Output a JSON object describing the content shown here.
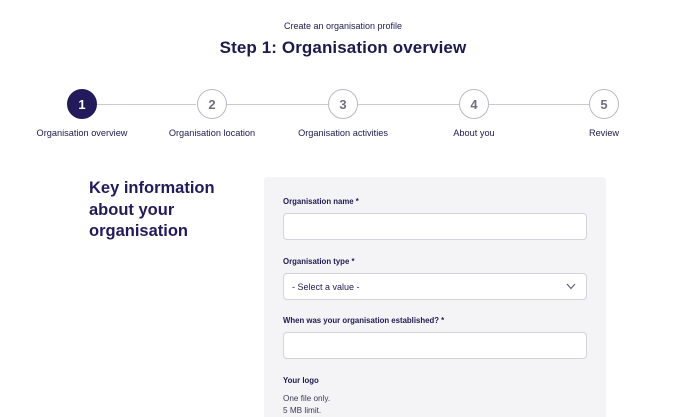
{
  "header": {
    "supertitle": "Create an organisation profile",
    "title": "Step 1: Organisation overview"
  },
  "stepper": {
    "steps": [
      {
        "number": "1",
        "label": "Organisation overview",
        "active": true
      },
      {
        "number": "2",
        "label": "Organisation location",
        "active": false
      },
      {
        "number": "3",
        "label": "Organisation activities",
        "active": false
      },
      {
        "number": "4",
        "label": "About you",
        "active": false
      },
      {
        "number": "5",
        "label": "Review",
        "active": false
      }
    ]
  },
  "section": {
    "heading": "Key information about your organisation"
  },
  "form": {
    "org_name_label": "Organisation name *",
    "org_name_value": "",
    "org_type_label": "Organisation type *",
    "org_type_value": "- Select a value -",
    "established_label": "When was your organisation established? *",
    "established_value": "",
    "logo_label": "Your logo",
    "logo_help_1": "One file only.",
    "logo_help_2": "5 MB limit."
  },
  "colors": {
    "primary": "#231a5c",
    "panel_bg": "#f4f4f7",
    "border": "#d3d3dc"
  }
}
